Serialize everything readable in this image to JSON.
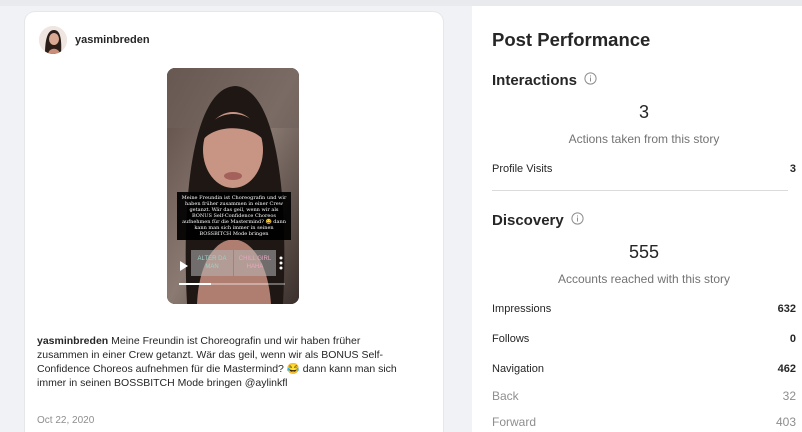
{
  "post": {
    "username": "yasminbreden",
    "story_overlay_text": "Meine Freundin ist Choreografin und wir haben früher zusammen in einer Crew getanzt. Wär das geil, wenn wir als BONUS Self-Confidence Choreos aufnehmen für die Mastermind? 😂 dann kann man sich immer in seinen BOSSBITCH Mode bringen",
    "sticker_left": "ALTER DA MAN",
    "sticker_right": "CHILL GIRL HAHA",
    "progress": 0.3,
    "caption_user": "yasminbreden",
    "caption_text": " Meine Freundin ist Choreografin und wir haben früher zusammen in einer Crew getanzt. Wär das geil, wenn wir als BONUS Self-Confidence Choreos aufnehmen für die Mastermind? 😂 dann kann man sich immer in seinen BOSSBITCH Mode bringen @aylinkfl",
    "date": "Oct 22, 2020"
  },
  "performance": {
    "title": "Post Performance",
    "interactions": {
      "heading": "Interactions",
      "value": "3",
      "description": "Actions taken from this story",
      "rows": [
        {
          "label": "Profile Visits",
          "value": "3"
        }
      ]
    },
    "discovery": {
      "heading": "Discovery",
      "value": "555",
      "description": "Accounts reached with this story",
      "rows": [
        {
          "label": "Impressions",
          "value": "632"
        },
        {
          "label": "Follows",
          "value": "0"
        },
        {
          "label": "Navigation",
          "value": "462"
        },
        {
          "label": "Back",
          "value": "32"
        },
        {
          "label": "Forward",
          "value": "403"
        }
      ]
    }
  },
  "colors": {
    "text_primary": "#262626",
    "text_secondary": "#737373",
    "background": "#f1f2f5"
  }
}
